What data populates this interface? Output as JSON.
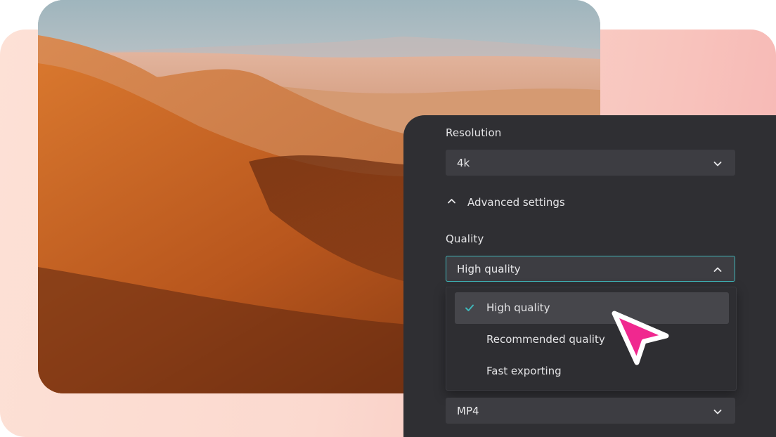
{
  "colors": {
    "panel_bg": "#2f2f33",
    "field_bg": "#3d3d42",
    "focus_border": "#3fb6b9",
    "check_color": "#3fb6b9",
    "cursor_fill": "#f0288f",
    "backdrop": "#fbd9cf"
  },
  "resolution": {
    "label": "Resolution",
    "value": "4k",
    "icon": "chevron-down-icon"
  },
  "advanced": {
    "label": "Advanced settings",
    "icon": "chevron-up-icon"
  },
  "quality": {
    "label": "Quality",
    "value": "High quality",
    "icon": "chevron-up-icon",
    "options": [
      {
        "label": "High quality",
        "selected": true,
        "icon": "check-icon"
      },
      {
        "label": "Recommended quality",
        "selected": false
      },
      {
        "label": "Fast exporting",
        "selected": false
      }
    ]
  },
  "format": {
    "value": "MP4",
    "icon": "chevron-down-icon"
  },
  "cursor": {
    "icon": "pointer-cursor-icon"
  }
}
